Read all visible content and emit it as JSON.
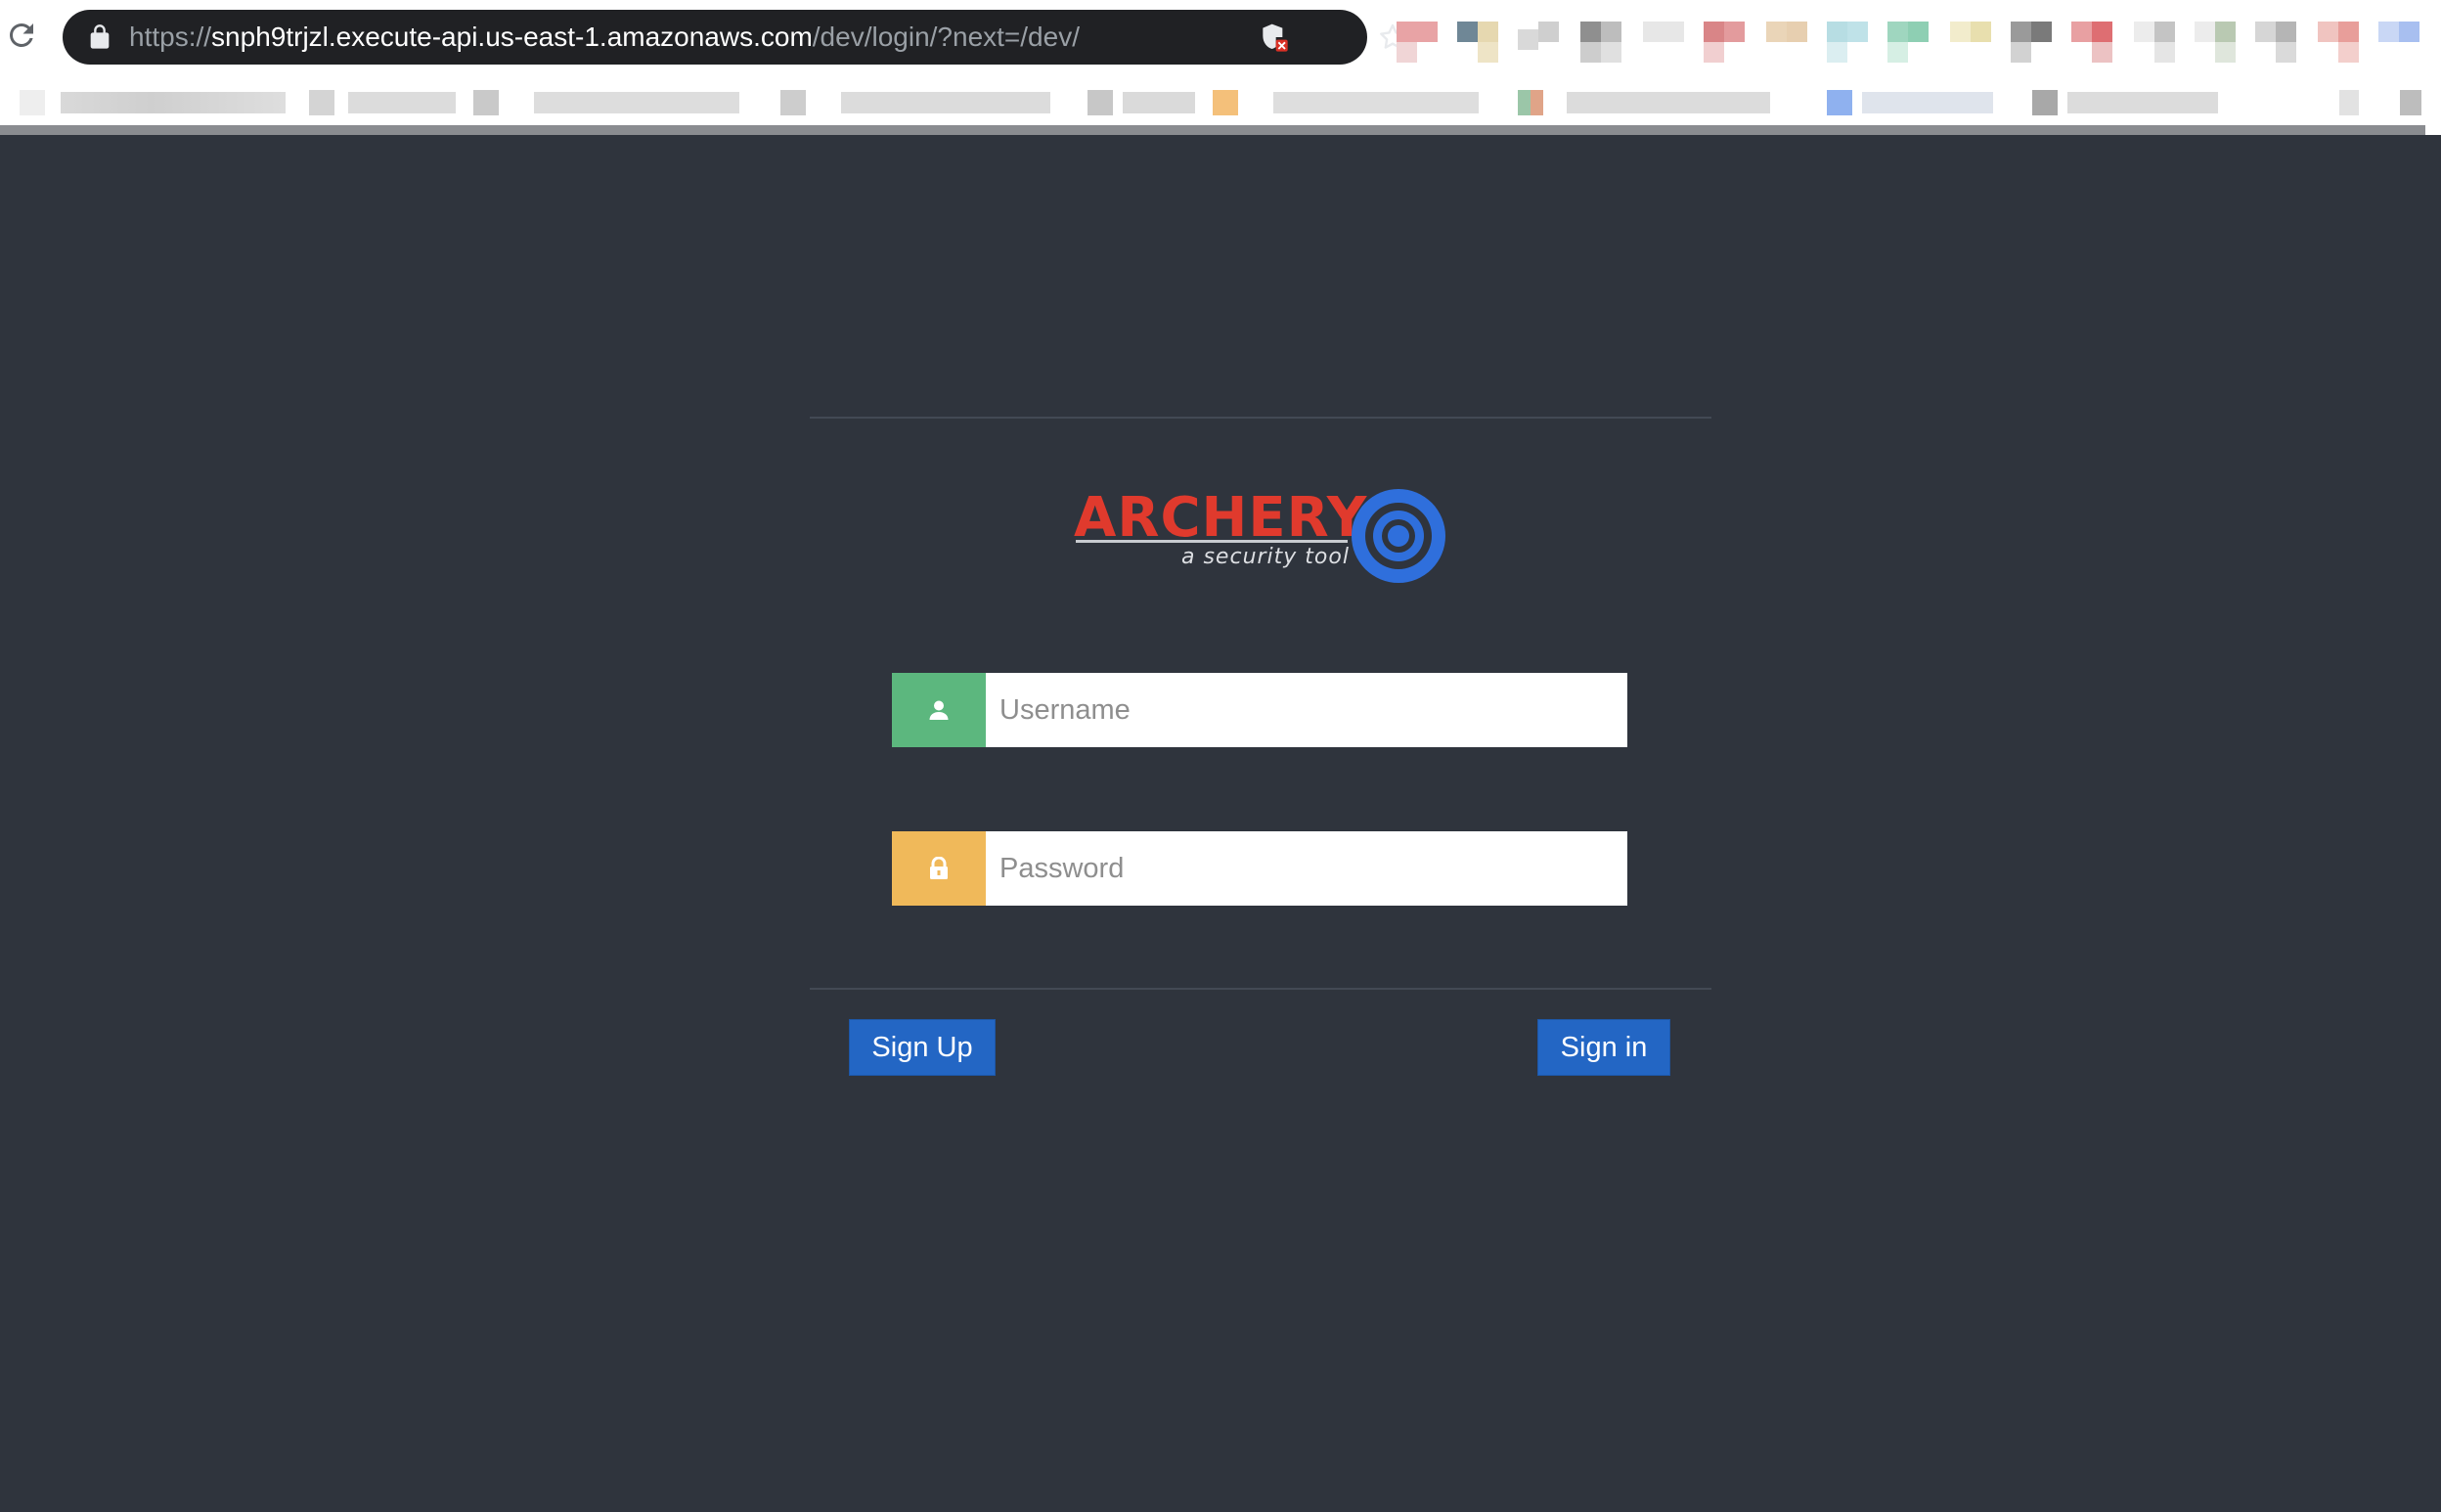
{
  "browser": {
    "url_scheme": "https://",
    "url_host": "snph9trjzl.execute-api.us-east-1.amazonaws.com",
    "url_path": "/dev/login/?next=/dev/",
    "icons": [
      "reload-icon",
      "lock-icon",
      "shield-blocked-icon",
      "star-icon"
    ]
  },
  "brand": {
    "name": "ARCHERY",
    "tagline": "a security tool",
    "name_color": "#e03a2d",
    "target_color": "#2f6fdc"
  },
  "form": {
    "username_placeholder": "Username",
    "password_placeholder": "Password",
    "username_icon": "user-icon",
    "password_icon": "lock-icon",
    "username_addon_color": "#5cb77e",
    "password_addon_color": "#f0b95a"
  },
  "actions": {
    "signup_label": "Sign Up",
    "signin_label": "Sign in",
    "button_color": "#2366c4"
  },
  "theme": {
    "background": "#2f343d"
  }
}
